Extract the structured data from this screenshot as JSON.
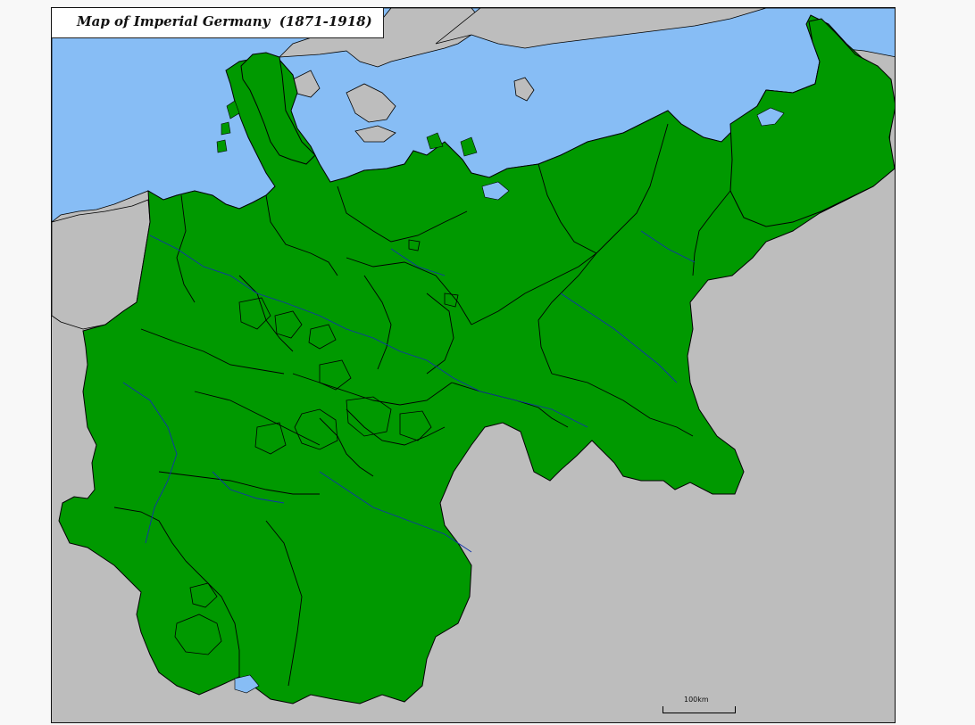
{
  "map": {
    "title": "Map of Imperial Germany",
    "years": "(1871-1918)",
    "scale_label": "100km",
    "colors": {
      "land_empire": "#009900",
      "land_other": "#bdbdbd",
      "water": "#87bdf5",
      "background": "#f8f8f8",
      "borders": "#000000",
      "rivers": "#1133aa"
    }
  }
}
